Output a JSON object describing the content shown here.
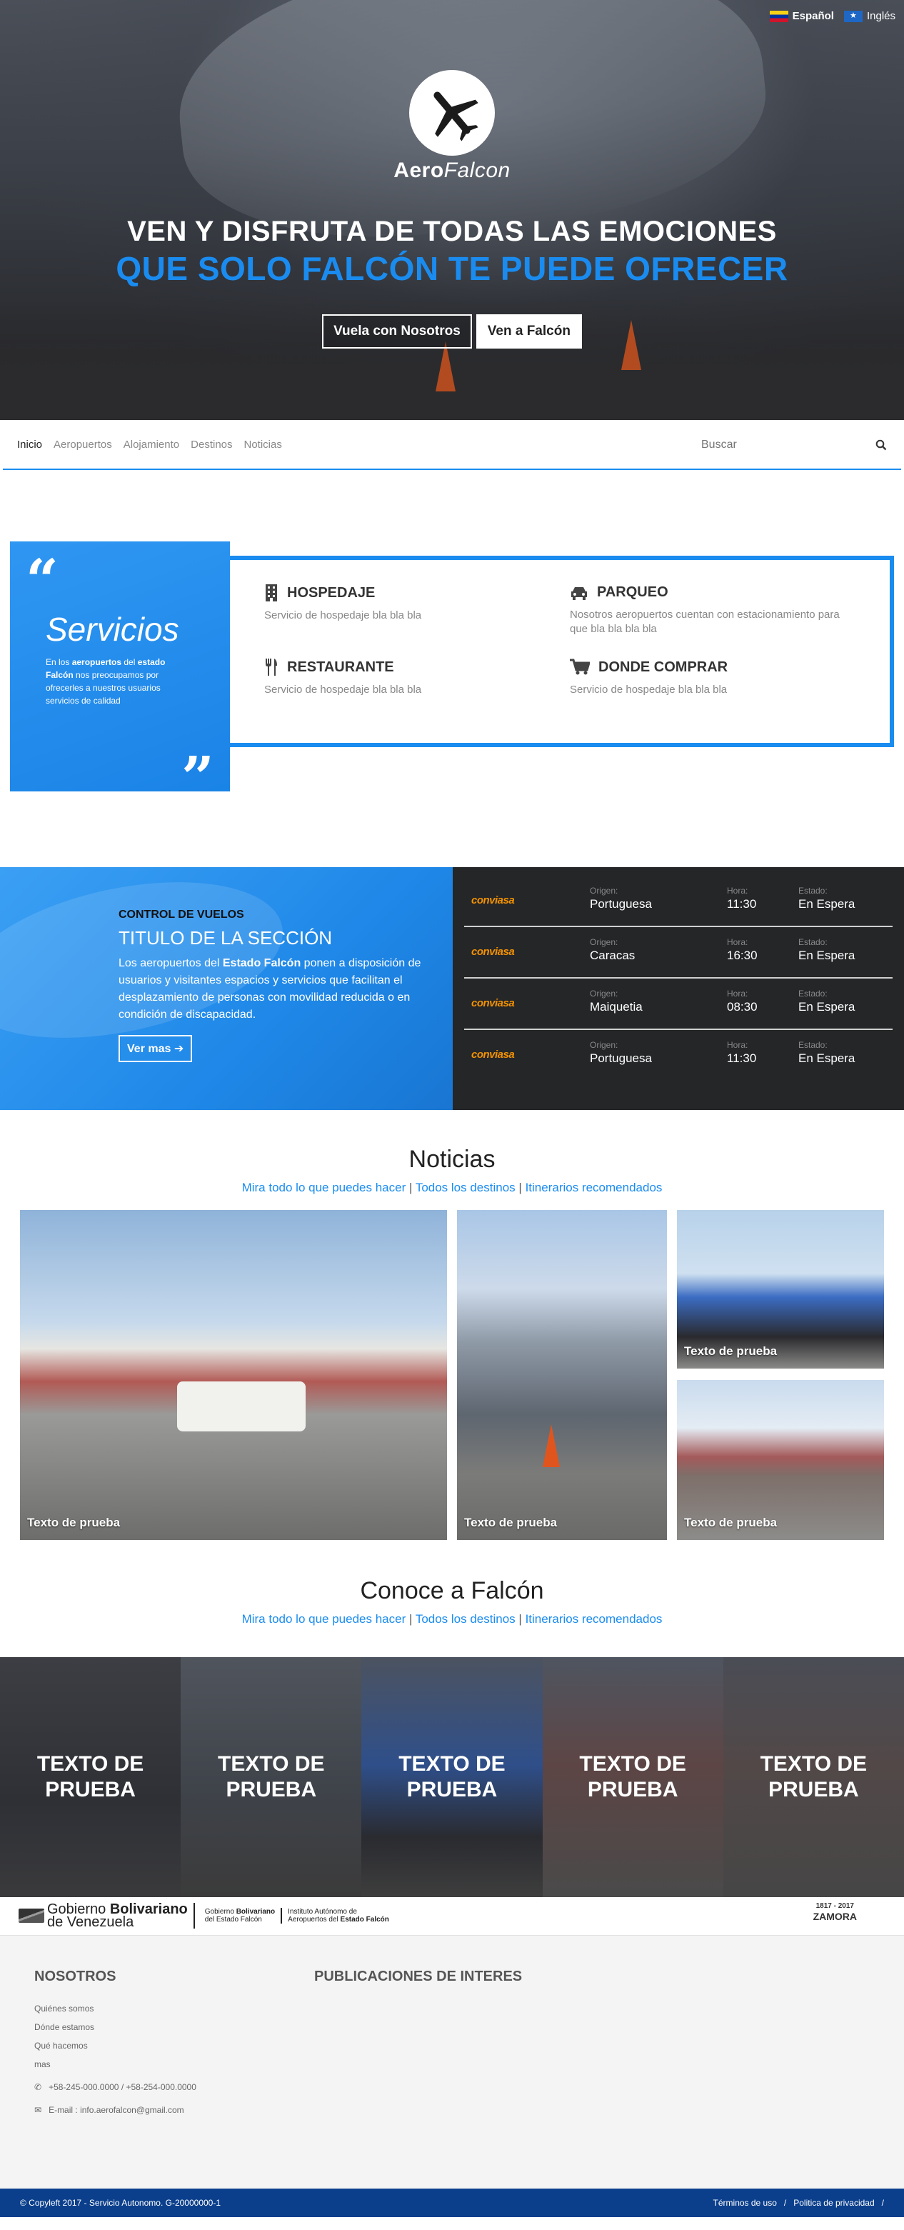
{
  "lang": {
    "es": "Español",
    "en": "Inglés"
  },
  "brand": {
    "aero": "Aero",
    "falcon": "Falcon"
  },
  "hero": {
    "line1": "VEN Y DISFRUTA DE TODAS LAS EMOCIONES",
    "line2": "QUE SOLO FALCÓN TE PUEDE OFRECER",
    "btn1": "Vuela con Nosotros",
    "btn2": "Ven a Falcón"
  },
  "nav": {
    "items": [
      "Inicio",
      "Aeropuertos",
      "Alojamiento",
      "Destinos",
      "Noticias"
    ],
    "search_placeholder": "Buscar"
  },
  "services": {
    "title": "Servicios",
    "desc_pre": "En los ",
    "desc_b1": "aeropuertos",
    "desc_mid": " del ",
    "desc_b2": "estado Falcón",
    "desc_post": " nos preocupamos por ofrecerles a nuestros usuarios servicios de calidad",
    "items": [
      {
        "icon": "building-icon",
        "title": "HOSPEDAJE",
        "text": "Servicio de hospedaje bla bla bla"
      },
      {
        "icon": "car-icon",
        "title": "PARQUEO",
        "text": "Nosotros aeropuertos cuentan con estacionamiento para que bla bla bla bla"
      },
      {
        "icon": "cutlery-icon",
        "title": "RESTAURANTE",
        "text": "Servicio de hospedaje bla bla bla"
      },
      {
        "icon": "cart-icon",
        "title": "DONDE COMPRAR",
        "text": "Servicio de hospedaje bla bla bla"
      }
    ]
  },
  "flights": {
    "kicker": "CONTROL DE VUELOS",
    "title": "TITULO DE LA SECCIÓN",
    "p_pre": "Los aeropuertos del ",
    "p_b": "Estado Falcón",
    "p_post": " ponen a disposición de usuarios y visitantes espacios y servicios que facilitan el desplazamiento de personas con movilidad reducida o en condición de discapacidad.",
    "more": "Ver mas",
    "labels": {
      "origin": "Origen:",
      "time": "Hora:",
      "status": "Estado:"
    },
    "rows": [
      {
        "airline": "conviasa",
        "origin": "Portuguesa",
        "time": "11:30",
        "status": "En Espera"
      },
      {
        "airline": "conviasa",
        "origin": "Caracas",
        "time": "16:30",
        "status": "En Espera"
      },
      {
        "airline": "conviasa",
        "origin": "Maiquetia",
        "time": "08:30",
        "status": "En Espera"
      },
      {
        "airline": "conviasa",
        "origin": "Portuguesa",
        "time": "11:30",
        "status": "En Espera"
      }
    ]
  },
  "news": {
    "title": "Noticias",
    "links": [
      "Mira todo lo que puedes hacer",
      "Todos los destinos",
      "Itinerarios recomendados"
    ],
    "separator": "|",
    "captions": [
      "Texto de prueba",
      "Texto de prueba",
      "Texto de prueba",
      "Texto de prueba"
    ]
  },
  "conoce": {
    "title": "Conoce a Falcón",
    "links": [
      "Mira todo lo que puedes hacer",
      "Todos los destinos",
      "Itinerarios recomendados"
    ],
    "separator": "|",
    "tiles": [
      "TEXTO DE PRUEBA",
      "TEXTO DE PRUEBA",
      "TEXTO DE PRUEBA",
      "TEXTO DE PRUEBA",
      "TEXTO DE PRUEBA"
    ]
  },
  "gov": {
    "g1a": "Gobierno ",
    "g1b": "Bolivariano",
    "g1c": "de Venezuela",
    "g2a": "Gobierno ",
    "g2b": "Bolivariano",
    "g2c": "del Estado Falcón",
    "g3a": "Instituto Autónomo de",
    "g3b": "Aeropuertos del ",
    "g3c": "Estado Falcón",
    "zamora_years": "1817 - 2017",
    "zamora_name": "ZAMORA"
  },
  "footer": {
    "col1_title": "NOSOTROS",
    "links": [
      "Quiénes somos",
      "Dónde estamos",
      "Qué hacemos",
      "mas"
    ],
    "phone": "+58-245-000.0000 / +58-254-000.0000",
    "email": "E-mail : info.aerofalcon@gmail.com",
    "col2_title": "PUBLICACIONES DE INTERES"
  },
  "bottom": {
    "copyright": "© Copyleft 2017 - Servicio Autonomo. G-20000000-1",
    "terms": "Términos de uso",
    "sep": "/",
    "privacy": "Politica de privacidad",
    "sep2": "/"
  }
}
